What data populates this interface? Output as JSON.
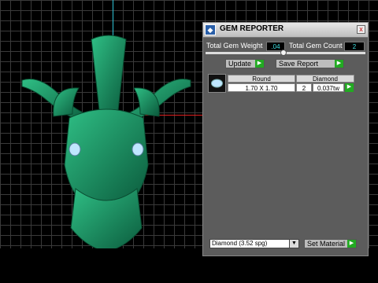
{
  "panel": {
    "title": "GEM REPORTER",
    "close": "x",
    "total_weight_label": "Total Gem Weight",
    "total_weight_value": ".04",
    "total_count_label": "Total Gem Count",
    "total_count_value": "2",
    "update_label": "Update",
    "save_report_label": "Save Report",
    "table": {
      "headers": [
        "Round",
        "Diamond"
      ],
      "row": {
        "size": "1.70 X 1.70",
        "count": "2",
        "weight": "0.037tw"
      }
    },
    "material": "Diamond    (3.52 spg)",
    "set_material_label": "Set Material"
  },
  "colors": {
    "model": "#1a8a60",
    "gem": "#bfe6ff",
    "grid": "#3a3a3a",
    "panel": "#5c5c5c"
  },
  "icons": {
    "title": "gem-reporter-app-icon",
    "arrow": "green-arrow-icon",
    "dropdown": "chevron-down-icon"
  }
}
